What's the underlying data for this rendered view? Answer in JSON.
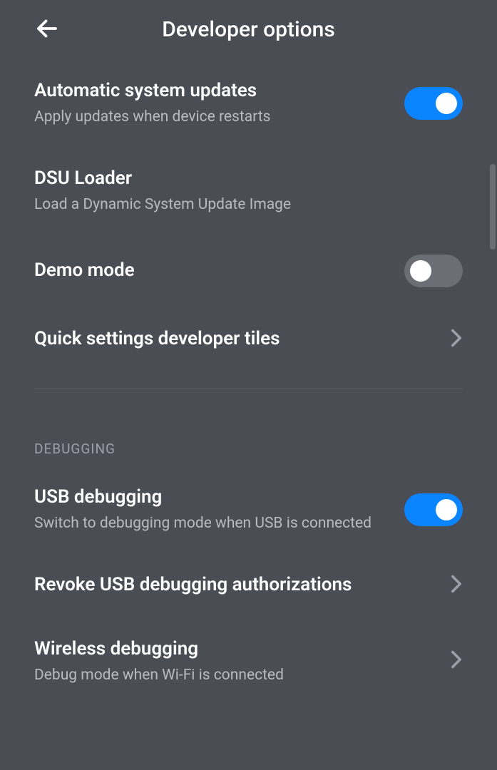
{
  "header": {
    "title": "Developer options"
  },
  "items": [
    {
      "title": "Automatic system updates",
      "subtitle": "Apply updates when device restarts",
      "toggle": true
    },
    {
      "title": "DSU Loader",
      "subtitle": "Load a Dynamic System Update Image"
    },
    {
      "title": "Demo mode",
      "toggle": false
    },
    {
      "title": "Quick settings developer tiles"
    }
  ],
  "section": {
    "header": "DEBUGGING"
  },
  "debugItems": [
    {
      "title": "USB debugging",
      "subtitle": "Switch to debugging mode when USB is connected",
      "toggle": true
    },
    {
      "title": "Revoke USB debugging authorizations"
    },
    {
      "title": "Wireless debugging",
      "subtitle": "Debug mode when Wi-Fi is connected"
    }
  ]
}
